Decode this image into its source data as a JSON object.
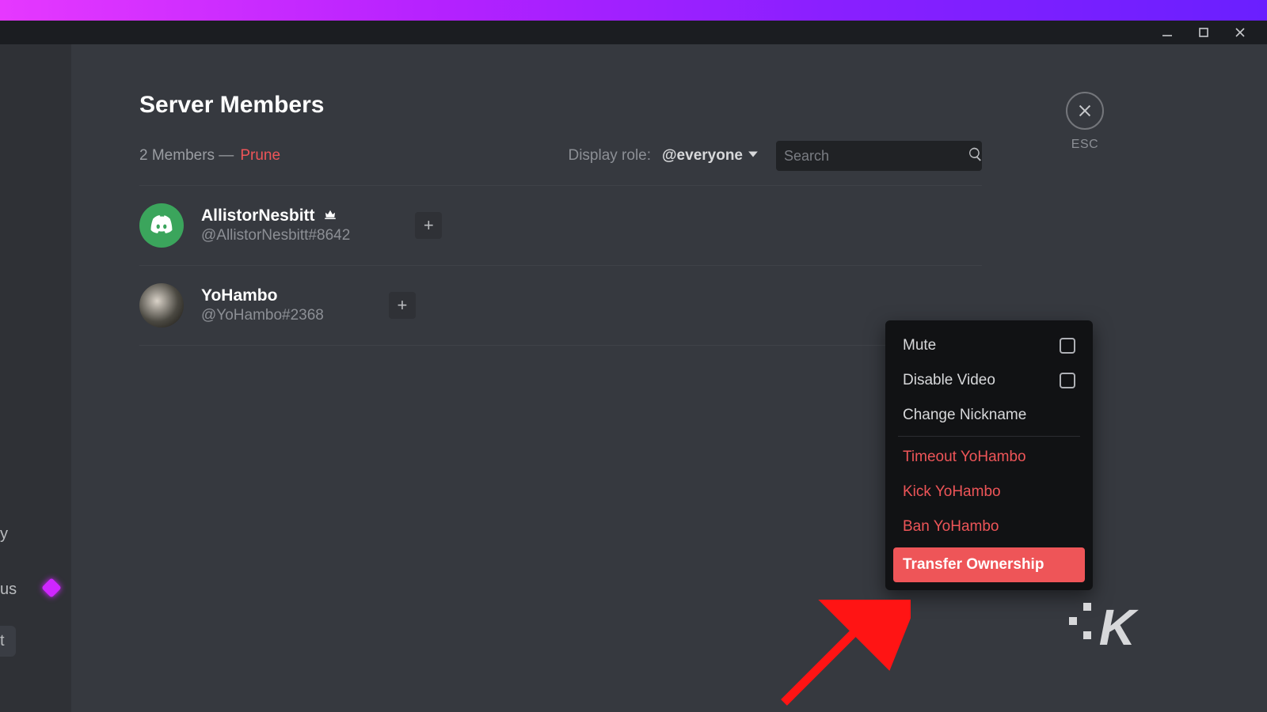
{
  "window": {
    "minimize_tip": "Minimize",
    "maximize_tip": "Maximize",
    "close_tip": "Close"
  },
  "close": {
    "esc_label": "ESC"
  },
  "page_title": "Server Members",
  "counts": {
    "member_count_text": "2 Members —"
  },
  "prune_label": "Prune",
  "role_filter": {
    "label": "Display role:",
    "selected": "@everyone"
  },
  "search": {
    "placeholder": "Search"
  },
  "members": [
    {
      "name": "AllistorNesbitt",
      "tag": "@AllistorNesbitt#8642",
      "owner": true
    },
    {
      "name": "YoHambo",
      "tag": "@YoHambo#2368",
      "owner": false
    }
  ],
  "context_menu": {
    "mute": "Mute",
    "disable_video": "Disable Video",
    "change_nickname": "Change Nickname",
    "timeout": "Timeout YoHambo",
    "kick": "Kick YoHambo",
    "ban": "Ban YoHambo",
    "transfer": "Transfer Ownership"
  },
  "sidebar": {
    "item_y": "y",
    "item_us": "us",
    "item_t": "t"
  },
  "watermark_letter": "K"
}
